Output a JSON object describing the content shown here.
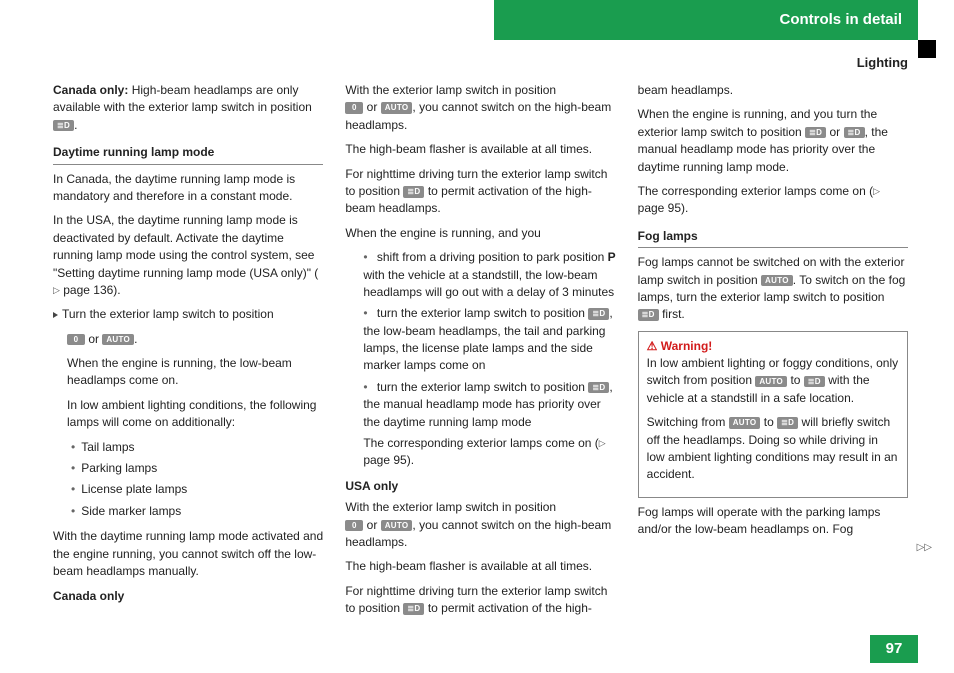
{
  "header": {
    "section": "Controls in detail",
    "sub": "Lighting",
    "page": "97"
  },
  "icons": {
    "zero": "0",
    "auto": "AUTO",
    "lowbeam": "≣D"
  },
  "col1": {
    "canada_only_b": "Canada only:",
    "canada_only": "High-beam headlamps are only available with the exterior lamp switch in position ",
    "h_daytime": "Daytime running lamp mode",
    "p1": "In Canada, the daytime running lamp mode is mandatory and therefore in a constant mode.",
    "p2a": "In the USA, the daytime running lamp mode is deactivated by default. Activate the daytime running lamp mode using the control system, see \"Setting daytime running lamp mode (USA only)\" (",
    "p2b": " page 136).",
    "b1a": "Turn the exterior lamp switch to position ",
    "b1b": " or ",
    "b1c": ".",
    "b1d": "When the engine is running, the low-beam headlamps come on.",
    "b1e": "In low ambient lighting conditions, the following lamps will come on additionally:",
    "li1": "Tail lamps",
    "li2": "Parking lamps",
    "li3": "License plate lamps",
    "li4": "Side marker lamps",
    "p3": "With the daytime running lamp mode activated and the engine running, you cannot switch off the low-beam headlamps manually."
  },
  "col2": {
    "h_canada": "Canada only",
    "p1a": "With the exterior lamp switch in position ",
    "p1b": " or ",
    "p1c": ", you cannot switch on the high-beam headlamps.",
    "p2": "The high-beam flasher is available at all times.",
    "p3a": "For nighttime driving turn the exterior lamp switch to position ",
    "p3b": " to permit activation of the high-beam headlamps.",
    "p4": "When the engine is running, and you",
    "li1a": "shift from a driving position to park position ",
    "li1p": "P",
    "li1b": " with the vehicle at a standstill, the low-beam headlamps will go out with a delay of 3 minutes",
    "li2a": "turn the exterior lamp switch to position ",
    "li2b": ", the low-beam headlamps, the tail and parking lamps, the license plate lamps and the side marker lamps come on",
    "li3a": "turn the exterior lamp switch to position ",
    "li3b": ", the manual headlamp mode has priority over the daytime running lamp mode",
    "li3c": "The corresponding exterior lamps come on (",
    "li3d": " page 95).",
    "h_usa": "USA only",
    "p5a": "With the exterior lamp switch in position ",
    "p5b": " or ",
    "p5c": ", you cannot switch on the high-beam headlamps."
  },
  "col3": {
    "p1": "The high-beam flasher is available at all times.",
    "p2a": "For nighttime driving turn the exterior lamp switch to position ",
    "p2b": " to permit activation of the high-beam headlamps.",
    "p3a": "When the engine is running, and you turn the exterior lamp switch to position ",
    "p3b": " or ",
    "p3c": ", the manual headlamp mode has priority over the daytime running lamp mode.",
    "p4a": "The corresponding exterior lamps come on (",
    "p4b": " page 95).",
    "h_fog": "Fog lamps",
    "p5a": "Fog lamps cannot be switched on with the exterior lamp switch in position ",
    "p5b": ". To switch on the fog lamps, turn the exterior lamp switch to position ",
    "p5c": " first.",
    "warn_t": "Warning!",
    "w1a": "In low ambient lighting or foggy conditions, only switch from position ",
    "w1b": " to ",
    "w1c": " with the vehicle at a standstill in a safe location.",
    "w2a": "Switching from ",
    "w2b": " to ",
    "w2c": " will briefly switch off the headlamps. Doing so while driving in low ambient lighting conditions may result in an accident.",
    "p6": "Fog lamps will operate with the parking lamps and/or the low-beam headlamps on. Fog"
  }
}
